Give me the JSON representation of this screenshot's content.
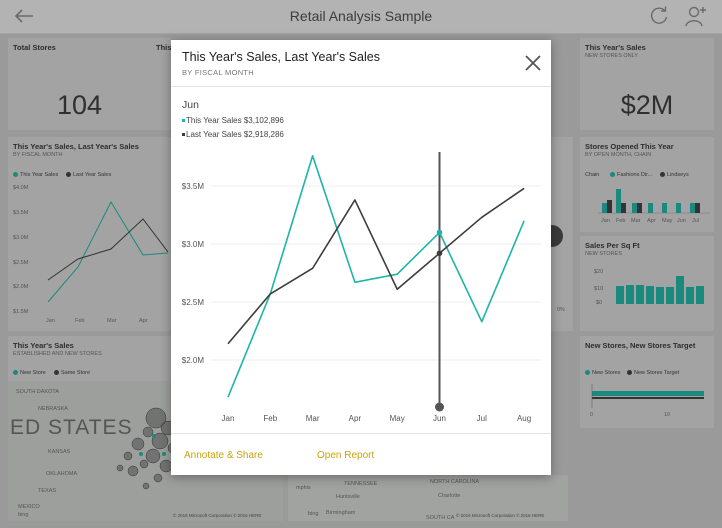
{
  "app": {
    "title": "Retail Analysis Sample",
    "back_icon": "back-arrow-icon",
    "refresh_icon": "refresh-icon",
    "add_user_icon": "add-user-icon"
  },
  "tiles": {
    "total_stores": {
      "title": "Total Stores",
      "value": "104"
    },
    "this_partial": {
      "title": "This"
    },
    "new_stores_sales": {
      "title": "This Year's Sales",
      "subtitle": "NEW STORES ONLY",
      "value": "$2M"
    },
    "sales_line": {
      "title": "This Year's Sales, Last Year's Sales",
      "subtitle": "BY FISCAL MONTH",
      "legend": [
        "This Year Sales",
        "Last Year Sales"
      ],
      "yticks": [
        "$4.0M",
        "$3.5M",
        "$3.0M",
        "$2.5M",
        "$2.0M",
        "$1.5M"
      ],
      "xticks": [
        "Jan",
        "Feb",
        "Mar",
        "Apr"
      ]
    },
    "stores_opened": {
      "title": "Stores Opened This Year",
      "subtitle": "BY OPEN MONTH, CHAIN",
      "legend_label": "Chain",
      "legend": [
        "Fashions Dir...",
        "Lindseys"
      ],
      "xticks": [
        "Jan",
        "Feb",
        "Mar",
        "Apr",
        "May",
        "Jun",
        "Jul"
      ]
    },
    "sales_per_sqft": {
      "title": "Sales Per Sq Ft",
      "subtitle": "NEW STORES",
      "yticks": [
        "$20",
        "$10",
        "$0"
      ]
    },
    "new_stores_target": {
      "title": "New Stores, New Stores Target",
      "legend": [
        "New Stores",
        "New Stores Target"
      ],
      "xticks": [
        "0",
        "10"
      ]
    },
    "established": {
      "title": "This Year's Sales",
      "subtitle": "ESTABLISHED AND NEW STORES",
      "legend": [
        "New Store",
        "Same Store"
      ],
      "map_text": "ED STATES",
      "copyright": "© 2016 Microsoft Corporation  © 2016 HERE",
      "bing": "bing",
      "small_labels": [
        "SOUTH DAKOTA",
        "NEBRASKA",
        "KANSAS",
        "OKLAHOMA",
        "TEXAS",
        "MEXICO"
      ]
    },
    "map2": {
      "labels": [
        "TENNESSEE",
        "Huntsville",
        "Birmingham",
        "mphis",
        "NORTH CAROLINA",
        "Charlotte",
        "SOUTH CA"
      ],
      "copyright": "© 2016 Microsoft Corporation  © 2016 HERE",
      "bing": "bing"
    },
    "pct_label": "0%"
  },
  "modal": {
    "title": "This Year's Sales, Last Year's Sales",
    "subtitle": "BY FISCAL MONTH",
    "close_icon": "close-icon",
    "tooltip": {
      "month": "Jun",
      "this_year": "This Year Sales $3,102,896",
      "last_year": "Last Year Sales $2,918,286"
    },
    "actions": {
      "annotate": "Annotate & Share",
      "open_report": "Open Report"
    }
  },
  "colors": {
    "this_year": "#1db5a6",
    "last_year": "#3d3d3d",
    "action": "#c9a30a"
  },
  "chart_data": {
    "type": "line",
    "categories": [
      "Jan",
      "Feb",
      "Mar",
      "Apr",
      "May",
      "Jun",
      "Jul",
      "Aug"
    ],
    "series": [
      {
        "name": "This Year Sales",
        "values": [
          1.68,
          2.57,
          3.76,
          2.67,
          2.74,
          3.1,
          2.33,
          3.2
        ]
      },
      {
        "name": "Last Year Sales",
        "values": [
          2.14,
          2.57,
          2.79,
          3.38,
          2.61,
          2.92,
          3.23,
          3.48
        ]
      }
    ],
    "yticks": [
      "$3.5M",
      "$3.0M",
      "$2.5M",
      "$2.0M"
    ],
    "ytick_values": [
      3.5,
      3.0,
      2.5,
      2.0
    ],
    "ylim": [
      1.5,
      4.0
    ],
    "selected_category": "Jun",
    "grid": true
  }
}
